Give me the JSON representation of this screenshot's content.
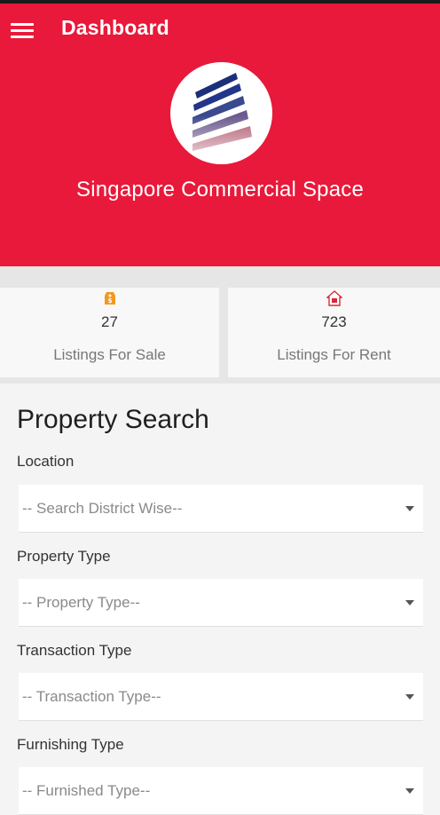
{
  "header": {
    "title": "Dashboard",
    "brand": "Singapore Commercial Space",
    "accent": "#e8193a"
  },
  "stats": {
    "sale": {
      "count": "27",
      "label": "Listings For Sale",
      "icon": "sale-tag-icon"
    },
    "rent": {
      "count": "723",
      "label": "Listings For Rent",
      "icon": "rent-house-icon"
    }
  },
  "search": {
    "title": "Property Search",
    "location": {
      "label": "Location",
      "placeholder": "-- Search District Wise--"
    },
    "property_type": {
      "label": "Property Type",
      "placeholder": "-- Property Type--"
    },
    "transaction_type": {
      "label": "Transaction Type",
      "placeholder": "-- Transaction Type--"
    },
    "furnishing_type": {
      "label": "Furnishing Type",
      "placeholder": "-- Furnished Type--"
    }
  }
}
